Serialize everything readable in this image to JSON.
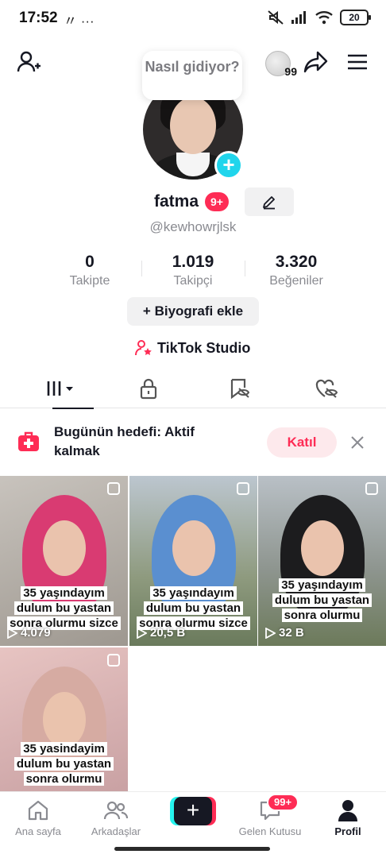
{
  "status_bar": {
    "time": "17:52",
    "left_icons": "〃 ···",
    "battery": "20"
  },
  "colors": {
    "accent": "#fe2c55",
    "teal": "#20d5ec",
    "text": "#161823",
    "muted": "#8a8b91"
  },
  "header": {
    "coin_count": "99",
    "speech_bubble": "Nasıl gidiyor?",
    "icons": [
      "add-user-icon",
      "coin-icon",
      "share-icon",
      "menu-icon"
    ]
  },
  "profile": {
    "name": "fatma",
    "badge": "9+",
    "handle": "@kewhowrjlsk",
    "stats": [
      {
        "value": "0",
        "label": "Takipte"
      },
      {
        "value": "1.019",
        "label": "Takipçi"
      },
      {
        "value": "3.320",
        "label": "Beğeniler"
      }
    ],
    "bio_button": "+ Biyografi ekle",
    "studio_link": "TikTok Studio"
  },
  "tabs": [
    "videos-tab",
    "private-tab",
    "reposts-tab",
    "liked-tab"
  ],
  "goal": {
    "text": "Bugünün hedefi: Aktif kalmak",
    "join": "Katıl"
  },
  "videos": [
    {
      "caption": "35 yaşındayım dulum bu yastan sonra olurmu sizce",
      "views": "4.079"
    },
    {
      "caption": "35 yaşındayım dulum bu yastan sonra olurmu sizce",
      "views": "20,5 B"
    },
    {
      "caption": "35 yaşındayım dulum bu yastan sonra olurmu",
      "views": "32 B"
    },
    {
      "caption": "35 yasindayim dulum bu yastan sonra olurmu",
      "views": ""
    }
  ],
  "bottom_nav": {
    "home": "Ana sayfa",
    "friends": "Arkadaşlar",
    "inbox": "Gelen Kutusu",
    "inbox_badge": "99+",
    "profile": "Profil"
  }
}
